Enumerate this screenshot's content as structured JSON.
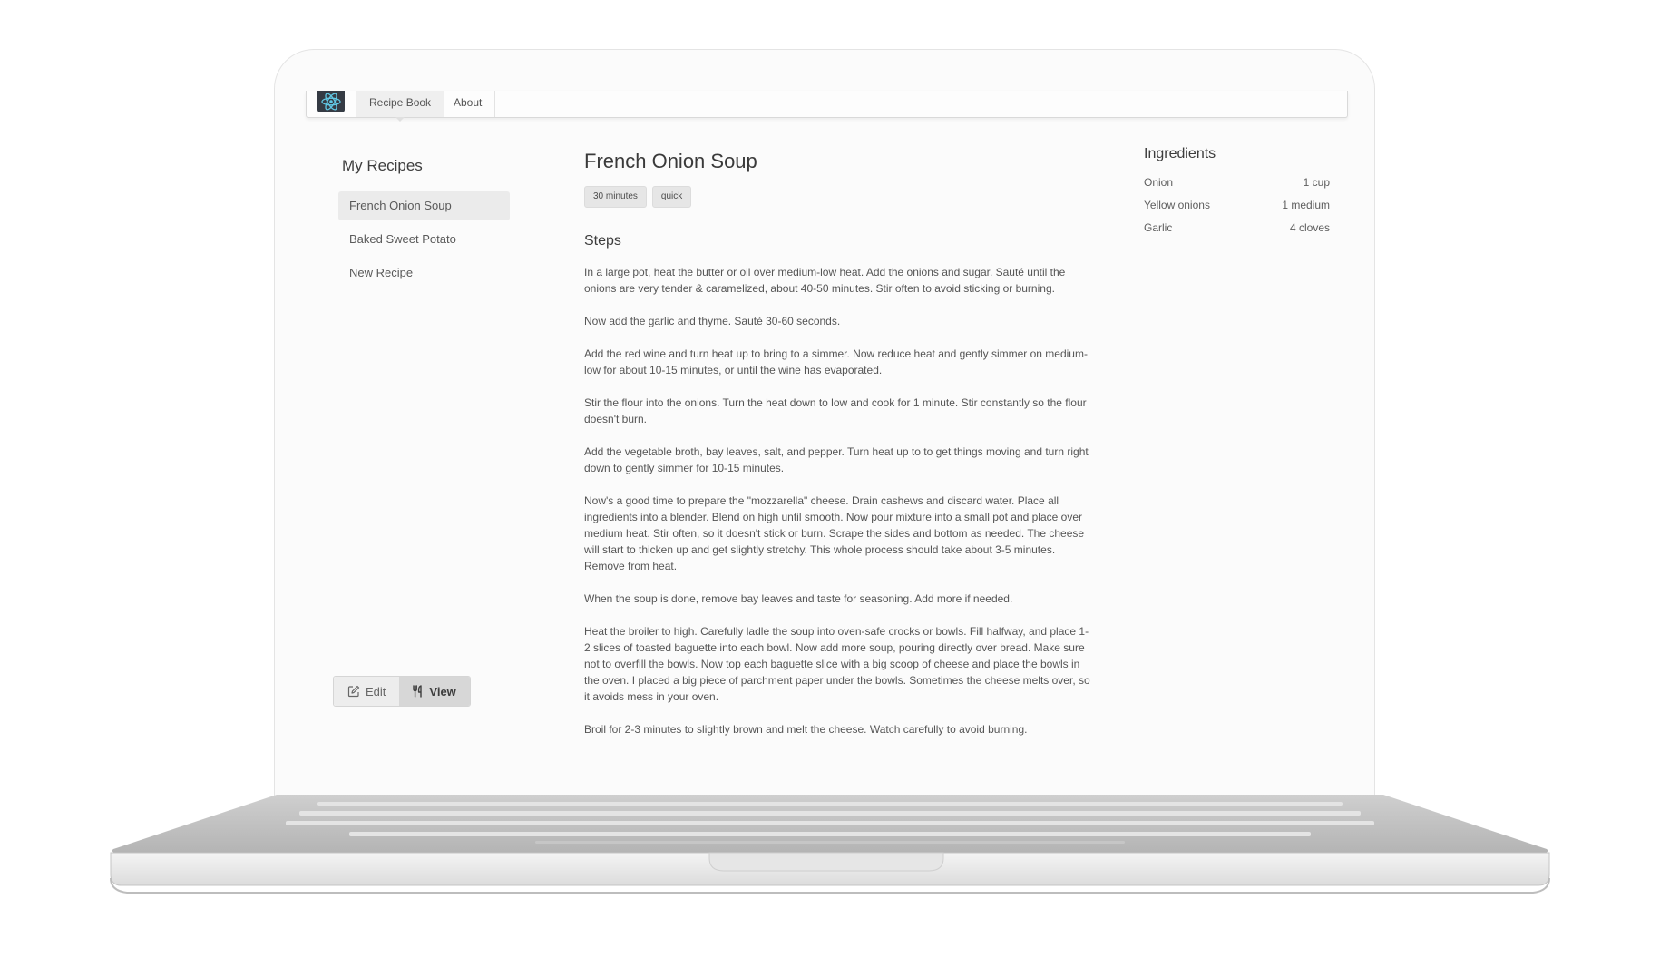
{
  "nav": {
    "logo": "react-atom-logo",
    "items": [
      {
        "label": "Recipe Book"
      },
      {
        "label": "About"
      }
    ]
  },
  "sidebar": {
    "title": "My Recipes",
    "recipes": [
      {
        "label": "French Onion Soup",
        "active": true
      },
      {
        "label": "Baked Sweet Potato"
      },
      {
        "label": "New Recipe"
      }
    ],
    "mode": {
      "edit_label": "Edit",
      "edit_icon": "edit-icon",
      "view_label": "View",
      "view_icon": "utensils-icon",
      "selected": "View"
    }
  },
  "recipe": {
    "title": "French Onion Soup",
    "tags": [
      "30 minutes",
      "quick"
    ],
    "steps_title": "Steps",
    "steps": [
      "In a large pot, heat the butter or oil over medium-low heat. Add the onions and sugar. Sauté until the onions are very tender & caramelized, about 40-50 minutes. Stir often to avoid sticking or burning.",
      "Now add the garlic and thyme. Sauté 30-60 seconds.",
      "Add the red wine and turn heat up to bring to a simmer. Now reduce heat and gently simmer on medium-low for about 10-15 minutes, or until the wine has evaporated.",
      "Stir the flour into the onions. Turn the heat down to low and cook for 1 minute. Stir constantly so the flour doesn't burn.",
      "Add the vegetable broth, bay leaves, salt, and pepper. Turn heat up to to get things moving and turn right down to gently simmer for 10-15 minutes.",
      "Now's a good time to prepare the \"mozzarella\" cheese. Drain cashews and discard water. Place all ingredients into a blender. Blend on high until smooth. Now pour mixture into a small pot and place over medium heat. Stir often, so it doesn't stick or burn. Scrape the sides and bottom as needed. The cheese will start to thicken up and get slightly stretchy. This whole process should take about 3-5 minutes. Remove from heat.",
      "When the soup is done, remove bay leaves and taste for seasoning. Add more if needed.",
      "Heat the broiler to high. Carefully ladle the soup into oven-safe crocks or bowls. Fill halfway, and place 1-2 slices of toasted baguette into each bowl. Now add more soup, pouring directly over bread. Make sure not to overfill the bowls. Now top each baguette slice with a big scoop of cheese and place the bowls in the oven. I placed a big piece of parchment paper under the bowls. Sometimes the cheese melts over, so it avoids mess in your oven.",
      "Broil for 2-3 minutes to slightly brown and melt the cheese. Watch carefully to avoid burning."
    ]
  },
  "ingredients": {
    "title": "Ingredients",
    "items": [
      {
        "name": "Onion",
        "amount": "1 cup"
      },
      {
        "name": "Yellow onions",
        "amount": "1 medium"
      },
      {
        "name": "Garlic",
        "amount": "4 cloves"
      }
    ]
  }
}
